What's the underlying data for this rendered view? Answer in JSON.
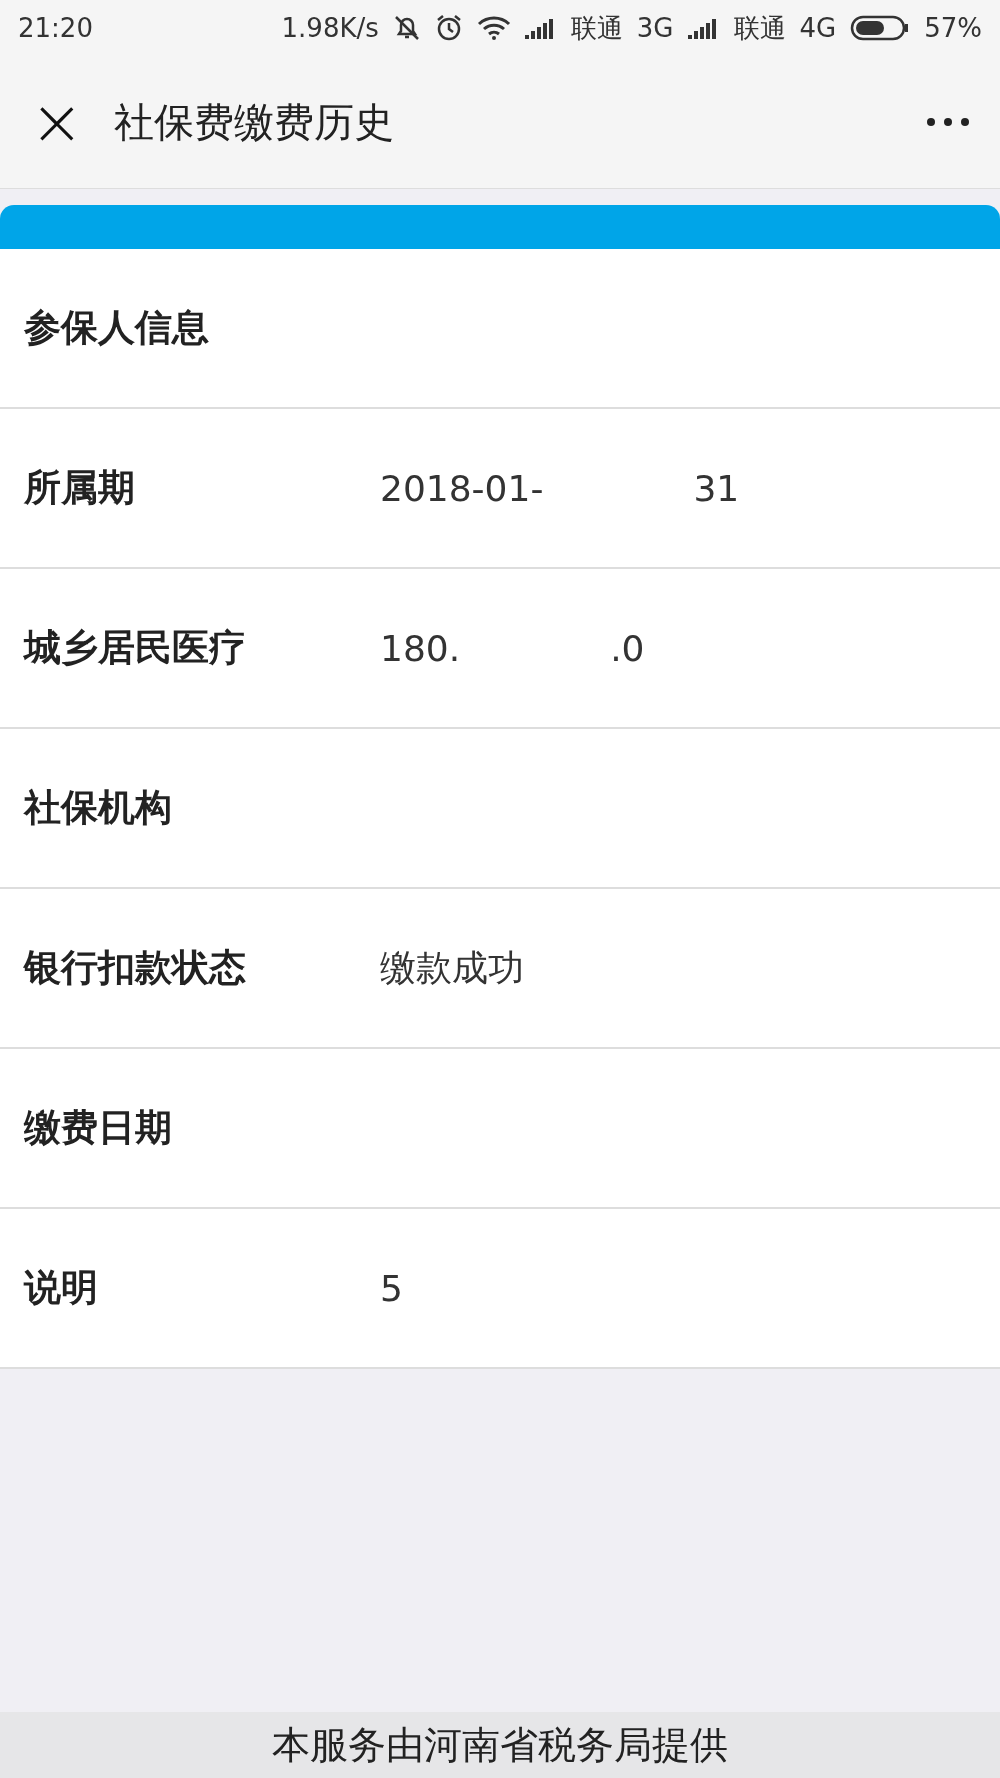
{
  "status_bar": {
    "time": "21:20",
    "speed": "1.98K/s",
    "carriers": [
      {
        "name": "联通",
        "network": "3G"
      },
      {
        "name": "联通",
        "network": "4G"
      }
    ],
    "battery": "57%"
  },
  "nav": {
    "title": "社保费缴费历史",
    "close": "×"
  },
  "rows": [
    {
      "label": "参保人信息",
      "values": []
    },
    {
      "label": "所属期",
      "values": [
        "2018-01-",
        "31"
      ]
    },
    {
      "label": "城乡居民医疗",
      "values": [
        "180.",
        ".0"
      ]
    },
    {
      "label": "社保机构",
      "values": []
    },
    {
      "label": "银行扣款状态",
      "values": [
        "缴款成功"
      ]
    },
    {
      "label": "缴费日期",
      "values": []
    },
    {
      "label": "说明",
      "values": [
        "5"
      ]
    }
  ],
  "footer": "本服务由河南省税务局提供"
}
